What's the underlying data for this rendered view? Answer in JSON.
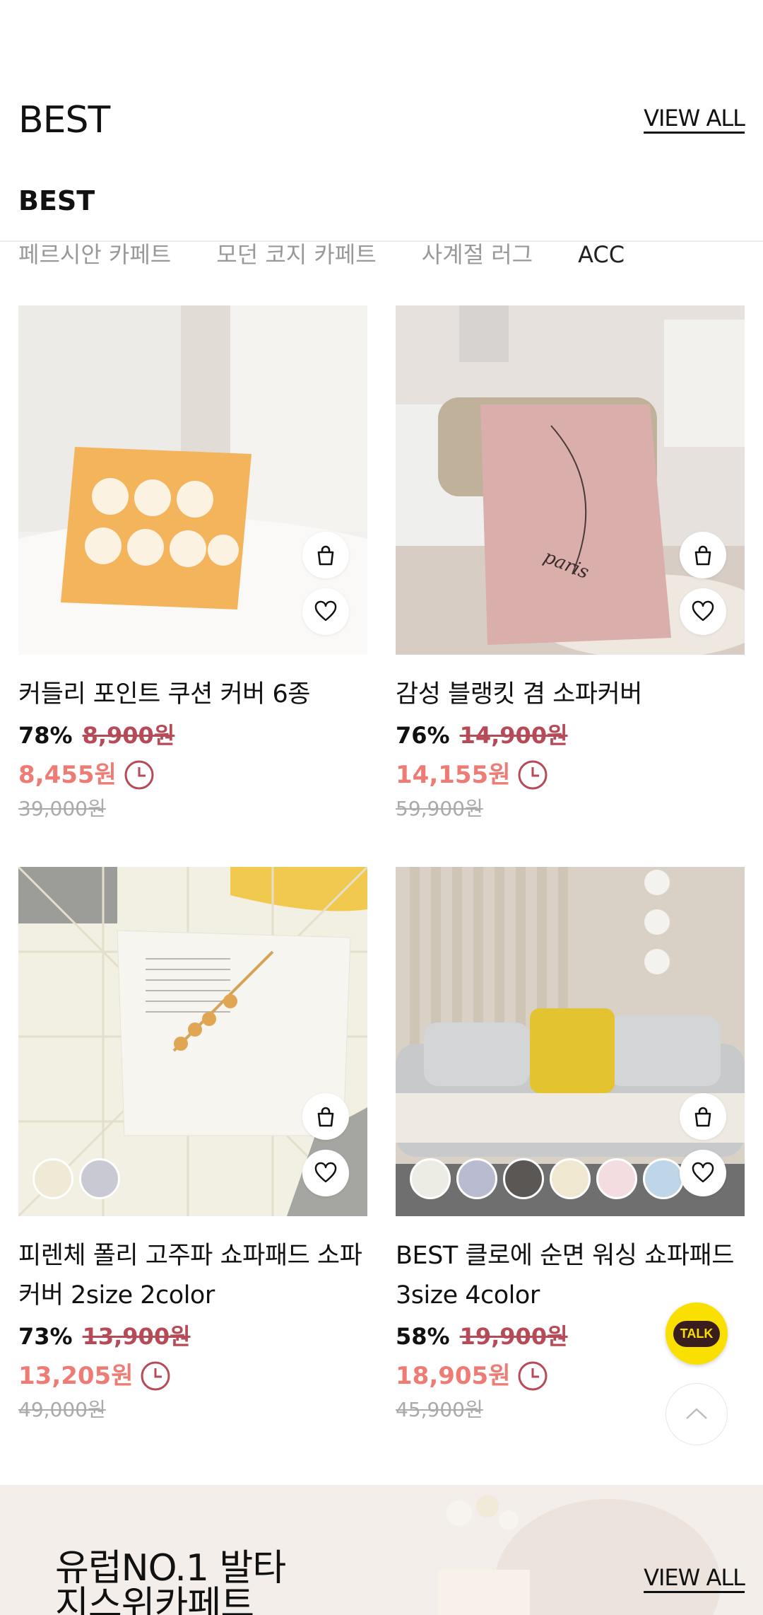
{
  "section": {
    "title": "BEST",
    "view_all": "VIEW ALL"
  },
  "sticky_title": "BEST",
  "tabs": [
    {
      "label": "페르시안 카페트"
    },
    {
      "label": "모던 코지 카페트"
    },
    {
      "label": "사계절 러그"
    },
    {
      "label": "ACC"
    }
  ],
  "products": [
    {
      "name": "커들리 포인트 쿠션 커버 6종",
      "rate": "78%",
      "orig": "8,900원",
      "sale": "8,455원",
      "list": "39,000원"
    },
    {
      "name": "감성 블랭킷 겸 소파커버",
      "rate": "76%",
      "orig": "14,900원",
      "sale": "14,155원",
      "list": "59,900원"
    },
    {
      "name": "피렌체 폴리 고주파 쇼파패드 소파커버 2size 2color",
      "rate": "73%",
      "orig": "13,900원",
      "sale": "13,205원",
      "list": "49,000원"
    },
    {
      "name": "BEST 클로에 순면 워싱 쇼파패드 3size 4color",
      "rate": "58%",
      "orig": "19,900원",
      "sale": "18,905원",
      "list": "45,900원"
    }
  ],
  "image_text": {
    "blanket_script": "paris"
  },
  "talk": {
    "label": "TALK"
  },
  "banner": {
    "title_line1": "유럽NO.1 발타",
    "title_line2": "지스위카페트",
    "view_all": "VIEW ALL"
  },
  "colors": {
    "sale": "#ee7c74",
    "strike": "#b74a57",
    "talk_yellow": "#f9e000"
  }
}
